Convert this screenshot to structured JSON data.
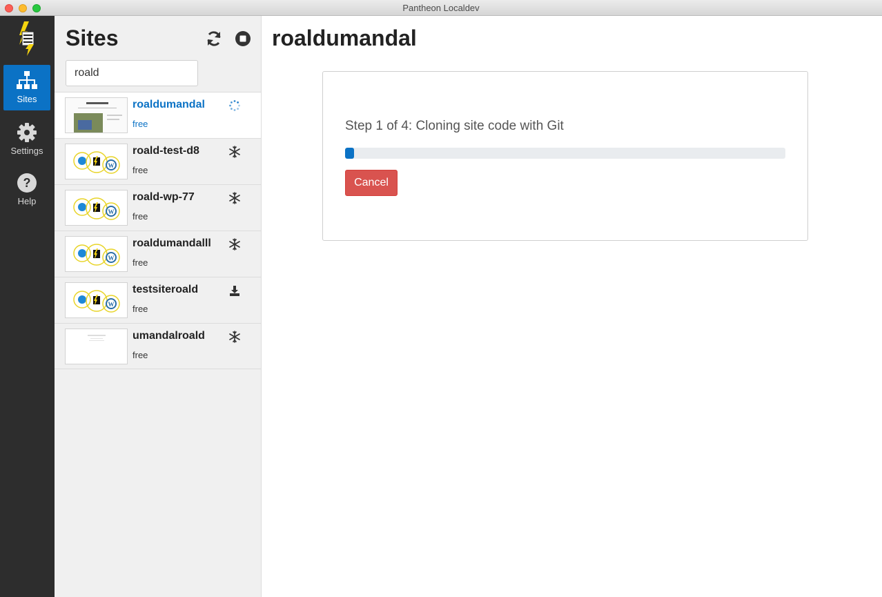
{
  "window": {
    "title": "Pantheon Localdev"
  },
  "nav": {
    "items": [
      {
        "label": "Sites",
        "icon": "sitemap-icon",
        "active": true
      },
      {
        "label": "Settings",
        "icon": "gear-icon",
        "active": false
      },
      {
        "label": "Help",
        "icon": "help-icon",
        "active": false
      }
    ]
  },
  "sites_panel": {
    "title": "Sites",
    "search": {
      "value": "roald",
      "placeholder": ""
    },
    "sites": [
      {
        "name": "roaldumandal",
        "plan": "free",
        "status_icon": "spinner-icon",
        "selected": true
      },
      {
        "name": "roald-test-d8",
        "plan": "free",
        "status_icon": "snowflake-icon",
        "selected": false
      },
      {
        "name": "roald-wp-77",
        "plan": "free",
        "status_icon": "snowflake-icon",
        "selected": false
      },
      {
        "name": "roaldumandalll",
        "plan": "free",
        "status_icon": "snowflake-icon",
        "selected": false
      },
      {
        "name": "testsiteroald",
        "plan": "free",
        "status_icon": "download-icon",
        "selected": false
      },
      {
        "name": "umandalroald",
        "plan": "free",
        "status_icon": "snowflake-icon",
        "selected": false
      }
    ]
  },
  "main": {
    "title": "roaldumandal",
    "step_text": "Step 1 of 4: Cloning site code with Git",
    "progress": 0.02,
    "cancel_label": "Cancel"
  },
  "colors": {
    "accent": "#0b72c5",
    "nav_bg": "#2d2d2d",
    "cancel": "#d9534f"
  }
}
